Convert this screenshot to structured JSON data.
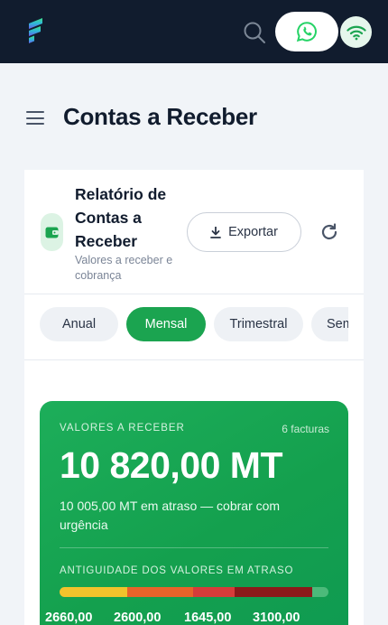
{
  "colors": {
    "topbar": "#111c2e",
    "accent": "#1ba450",
    "whatsapp": "#25d366",
    "aging_segments": [
      "#f2c32c",
      "#e8632a",
      "#d63c3a",
      "#8b1a1a",
      "#4cba7a"
    ]
  },
  "header": {
    "logo_icon": "brand-logo-icon",
    "search_icon": "search-icon",
    "whatsapp_icon": "whatsapp-icon",
    "wifi_icon": "wifi-icon"
  },
  "page": {
    "title": "Contas a Receber",
    "menu_icon": "hamburger-menu-icon"
  },
  "report": {
    "title": "Relatório de Contas a Receber",
    "subtitle": "Valores a receber e cobrança",
    "export_label": "Exportar",
    "refresh_icon": "refresh-icon"
  },
  "tabs": [
    {
      "label": "Anual",
      "active": false
    },
    {
      "label": "Mensal",
      "active": true
    },
    {
      "label": "Trimestral",
      "active": false
    },
    {
      "label": "Semestral",
      "active": false
    }
  ],
  "summary": {
    "label": "VALORES A RECEBER",
    "count": "6 facturas",
    "amount": "10 820,00 MT",
    "overdue": "10 005,00 MT em atraso — cobrar com urgência",
    "aging_title": "ANTIGUIDADE DOS VALORES EM ATRASO",
    "aging_values": [
      "2660,00",
      "2600,00",
      "1645,00",
      "3100,00"
    ],
    "aging_shares": [
      0.25,
      0.245,
      0.155,
      0.29,
      0.06
    ]
  }
}
